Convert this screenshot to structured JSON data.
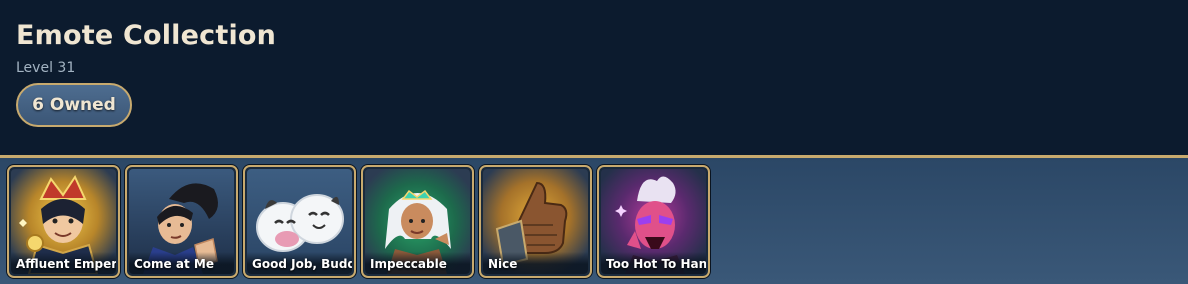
{
  "header": {
    "title": "Emote Collection",
    "level": "Level 31",
    "owned_label": "6 Owned"
  },
  "colors": {
    "background": "#0c1b2e",
    "accent_gold": "#c8aa6e",
    "title_text": "#f0e6d2"
  },
  "emotes": [
    {
      "label": "Affluent Emper",
      "icon": "emperor-portrait-icon"
    },
    {
      "label": "Come at Me",
      "icon": "swordsman-portrait-icon"
    },
    {
      "label": "Good Job, Budd",
      "icon": "poro-pair-icon"
    },
    {
      "label": "Impeccable",
      "icon": "queen-portrait-icon"
    },
    {
      "label": "Nice",
      "icon": "gauntlet-thumbs-up-icon"
    },
    {
      "label": "Too Hot To Han",
      "icon": "demon-portrait-icon"
    }
  ]
}
